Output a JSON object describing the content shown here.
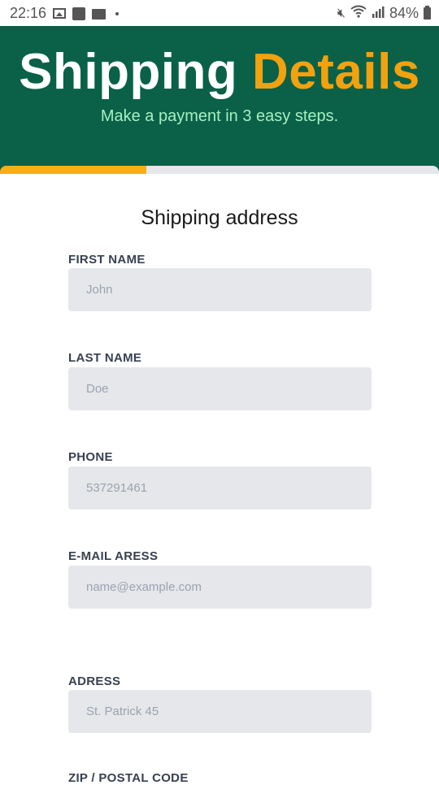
{
  "status_bar": {
    "time": "22:16",
    "battery": "84%",
    "icons": [
      "image-icon",
      "puzzle-icon",
      "folder-icon",
      "dot-icon",
      "mute-icon",
      "wifi-icon",
      "signal-icon",
      "battery-icon"
    ]
  },
  "header": {
    "title_part1": "Shipping",
    "title_part2": "Details",
    "subtitle": "Make a payment in 3 easy steps.",
    "colors": {
      "background": "#0a6148",
      "title_accent": "#f2a20f",
      "subtitle": "#a6efc0"
    }
  },
  "progress": {
    "fraction": 0.333,
    "color": "#f5b014"
  },
  "form": {
    "section_title": "Shipping address",
    "fields": [
      {
        "label": "FIRST NAME",
        "placeholder": "John"
      },
      {
        "label": "LAST NAME",
        "placeholder": "Doe"
      },
      {
        "label": "PHONE",
        "placeholder": "537291461"
      },
      {
        "label": "E-MAIL ARESS",
        "placeholder": "name@example.com"
      },
      {
        "label": "ADRESS",
        "placeholder": "St. Patrick 45"
      },
      {
        "label": "ZIP / POSTAL CODE"
      }
    ]
  }
}
